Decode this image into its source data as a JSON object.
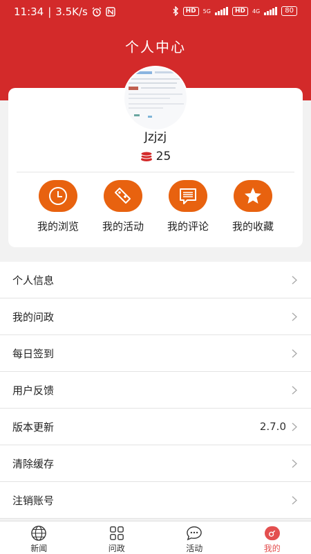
{
  "status_bar": {
    "time": "11:34",
    "speed": "3.5K/s",
    "network_5g": "5G",
    "network_4g": "4G",
    "hd": "HD",
    "battery": "80"
  },
  "header": {
    "title": "个人中心"
  },
  "profile": {
    "username": "Jzjzj",
    "coins": "25"
  },
  "quick_actions": [
    {
      "label": "我的浏览",
      "icon": "clock-icon"
    },
    {
      "label": "我的活动",
      "icon": "tag-plus-icon"
    },
    {
      "label": "我的评论",
      "icon": "comment-icon"
    },
    {
      "label": "我的收藏",
      "icon": "star-icon"
    }
  ],
  "menu": [
    {
      "label": "个人信息",
      "value": ""
    },
    {
      "label": "我的问政",
      "value": ""
    },
    {
      "label": "每日签到",
      "value": ""
    },
    {
      "label": "用户反馈",
      "value": ""
    },
    {
      "label": "版本更新",
      "value": "2.7.0"
    },
    {
      "label": "清除缓存",
      "value": ""
    },
    {
      "label": "注销账号",
      "value": ""
    }
  ],
  "bottom_nav": [
    {
      "label": "新闻",
      "icon": "globe-icon"
    },
    {
      "label": "问政",
      "icon": "grid-icon"
    },
    {
      "label": "活动",
      "icon": "chat-icon"
    },
    {
      "label": "我的",
      "icon": "profile-icon",
      "active": true
    }
  ],
  "colors": {
    "header_red": "#d32a2a",
    "action_orange": "#e8620f",
    "coin_red": "#d32a2a",
    "active_nav": "#e34f4f"
  }
}
